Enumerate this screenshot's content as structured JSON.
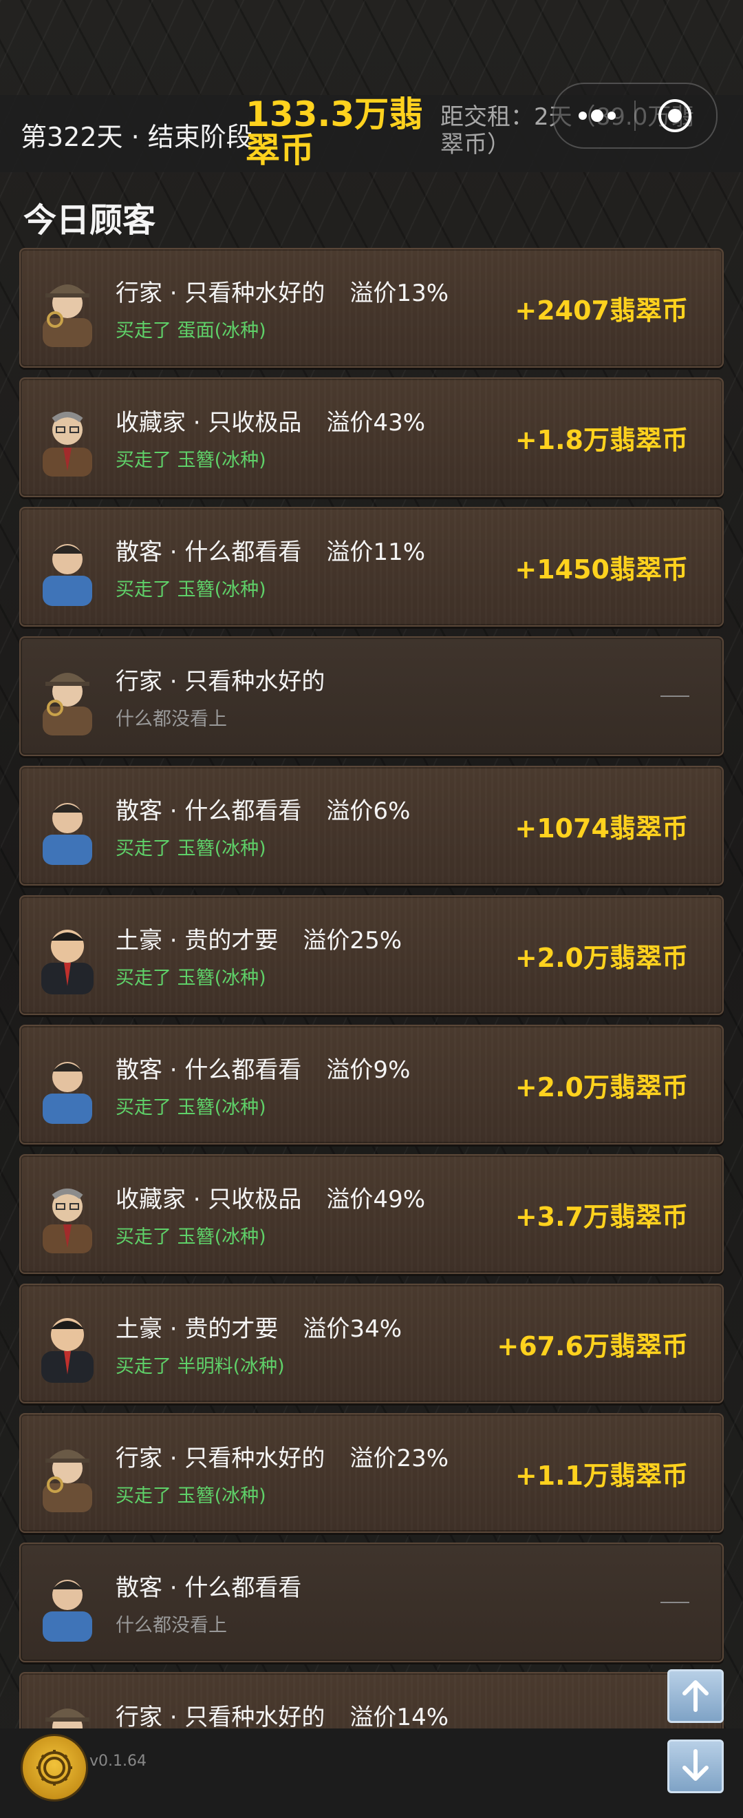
{
  "header": {
    "day_stage": "第322天 · 结束阶段",
    "money": "133.3万翡翠币",
    "rent_info": "距交租：2天（89.0万翡翠币）"
  },
  "section_title": "今日顾客",
  "customers": [
    {
      "name": "行家 · 只看种水好的",
      "premium": "溢价13%",
      "result": "买走了 蛋面(冰种)",
      "amount": "+2407翡翠币",
      "avatar": "detective-avatar"
    },
    {
      "name": "收藏家 · 只收极品",
      "premium": "溢价43%",
      "result": "买走了 玉簪(冰种)",
      "amount": "+1.8万翡翠币",
      "avatar": "collector-avatar"
    },
    {
      "name": "散客 · 什么都看看",
      "premium": "溢价11%",
      "result": "买走了 玉簪(冰种)",
      "amount": "+1450翡翠币",
      "avatar": "casual-avatar"
    },
    {
      "name": "行家 · 只看种水好的",
      "premium": "",
      "result": "什么都没看上",
      "amount": "",
      "avatar": "detective-avatar"
    },
    {
      "name": "散客 · 什么都看看",
      "premium": "溢价6%",
      "result": "买走了 玉簪(冰种)",
      "amount": "+1074翡翠币",
      "avatar": "casual-avatar"
    },
    {
      "name": "土豪 · 贵的才要",
      "premium": "溢价25%",
      "result": "买走了 玉簪(冰种)",
      "amount": "+2.0万翡翠币",
      "avatar": "rich-avatar"
    },
    {
      "name": "散客 · 什么都看看",
      "premium": "溢价9%",
      "result": "买走了 玉簪(冰种)",
      "amount": "+2.0万翡翠币",
      "avatar": "casual-avatar"
    },
    {
      "name": "收藏家 · 只收极品",
      "premium": "溢价49%",
      "result": "买走了 玉簪(冰种)",
      "amount": "+3.7万翡翠币",
      "avatar": "collector-avatar"
    },
    {
      "name": "土豪 · 贵的才要",
      "premium": "溢价34%",
      "result": "买走了 半明料(冰种)",
      "amount": "+67.6万翡翠币",
      "avatar": "rich-avatar"
    },
    {
      "name": "行家 · 只看种水好的",
      "premium": "溢价23%",
      "result": "买走了 玉簪(冰种)",
      "amount": "+1.1万翡翠币",
      "avatar": "detective-avatar"
    },
    {
      "name": "散客 · 什么都看看",
      "premium": "",
      "result": "什么都没看上",
      "amount": "",
      "avatar": "casual-avatar"
    },
    {
      "name": "行家 · 只看种水好的",
      "premium": "溢价14%",
      "result": "",
      "amount": "",
      "avatar": "detective-avatar"
    }
  ],
  "footer": {
    "version": "v0.1.64"
  },
  "colors": {
    "gold": "#ffd21e",
    "green": "#5fd169",
    "card": "#4a3a2e"
  }
}
